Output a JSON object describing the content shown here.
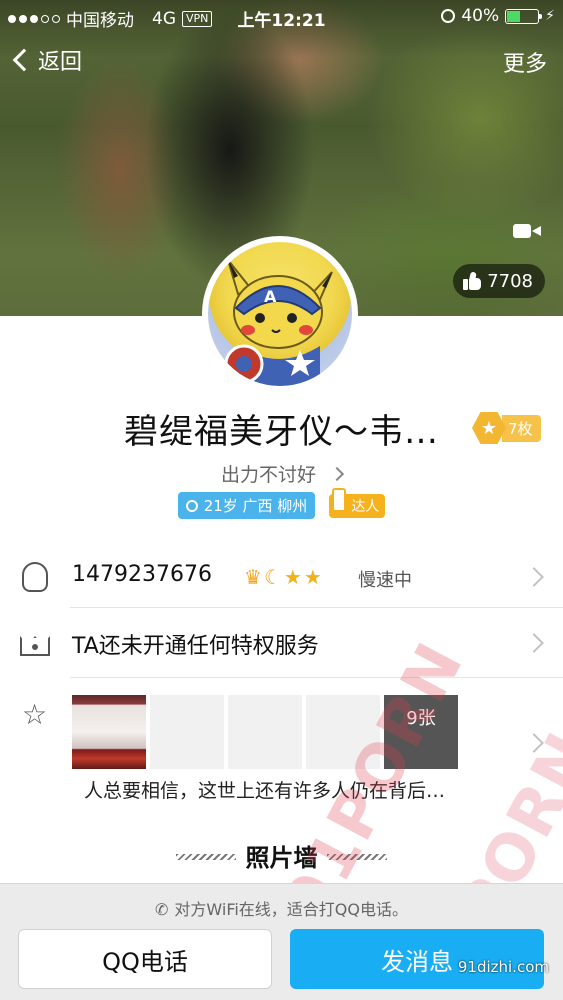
{
  "status_bar": {
    "carrier": "中国移动",
    "network": "4G",
    "vpn": "VPN",
    "time": "上午12:21",
    "battery_percent": "40%",
    "battery_level": 0.4
  },
  "nav": {
    "back_label": "返回",
    "more_label": "更多"
  },
  "hero": {
    "like_count": "7708",
    "video_icon": "video-camera-icon"
  },
  "profile": {
    "name": "碧缇福美牙仪～韦…",
    "medal_count": "7枚",
    "signature": "出力不讨好",
    "info_tag": "21岁 广西 柳州",
    "daren_tag": "达人"
  },
  "rows": {
    "qq_number": "1479237676",
    "qq_status": "慢速中",
    "privilege": "TA还未开通任何特权服务",
    "photo_count": "9张",
    "photo_caption": "人总要相信，这世上还有许多人仍在背后…"
  },
  "section": {
    "title": "照片墙"
  },
  "bottom": {
    "wifi_tip": "对方WiFi在线，适合打QQ电话。",
    "call_label": "QQ电话",
    "message_label": "发消息"
  },
  "watermark": {
    "text": "91PORN",
    "site": "91dizhi.com"
  },
  "colors": {
    "accent": "#19aef3",
    "tag_blue": "#4ab3ec",
    "gold": "#f2b630"
  }
}
